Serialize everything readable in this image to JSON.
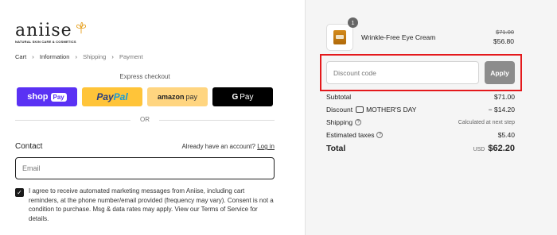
{
  "brand": {
    "name": "aniise",
    "tagline": "NATURAL SKIN CARE & COSMETICS"
  },
  "breadcrumb": {
    "items": [
      "Cart",
      "Information",
      "Shipping",
      "Payment"
    ]
  },
  "express": {
    "title": "Express checkout",
    "shoppay_text": "shop",
    "shoppay_pill": "Pay",
    "paypal_text_1": "Pay",
    "paypal_text_2": "Pal",
    "amazon_text_1": "amazon",
    "amazon_text_2": "pay",
    "gpay_g": "G",
    "gpay_text": "Pay",
    "or": "OR"
  },
  "contact": {
    "label": "Contact",
    "account_prompt": "Already have an account?",
    "login_link": "Log in",
    "email_placeholder": "Email"
  },
  "consent": {
    "checked": true,
    "text": "I agree to receive automated marketing messages from Aniise, including cart reminders, at the phone number/email provided (frequency may vary). Consent is not a condition to purchase. Msg & data rates may apply. View our Terms of Service for details."
  },
  "order": {
    "item": {
      "quantity": "1",
      "name": "Wrinkle-Free Eye Cream",
      "original_price": "$71.00",
      "price": "$56.80"
    },
    "discount_placeholder": "Discount code",
    "apply_label": "Apply",
    "subtotal_label": "Subtotal",
    "subtotal_value": "$71.00",
    "discount_label": "Discount",
    "discount_code": "MOTHER'S DAY",
    "discount_value": "− $14.20",
    "shipping_label": "Shipping",
    "shipping_value": "Calculated at next step",
    "taxes_label": "Estimated taxes",
    "taxes_value": "$5.40",
    "total_label": "Total",
    "total_currency": "USD",
    "total_value": "$62.20"
  },
  "colors": {
    "shoppay": "#5a31f4",
    "paypal": "#ffc439",
    "amazonpay": "#ffd580",
    "gpay": "#000000",
    "highlight": "#e4191c",
    "apply": "#8c8c8c"
  }
}
